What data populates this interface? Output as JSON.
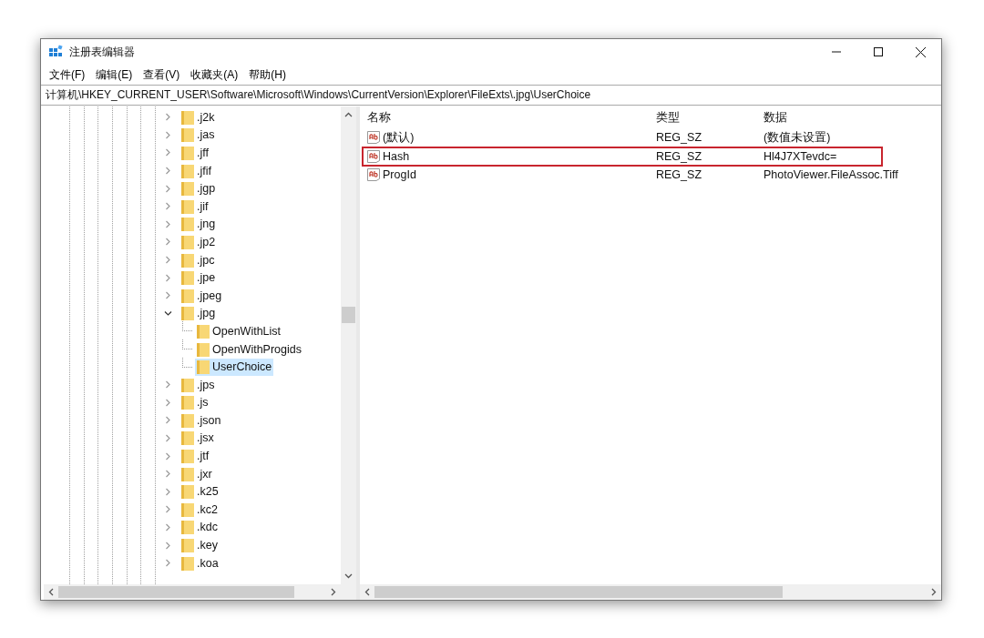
{
  "window": {
    "title": "注册表编辑器"
  },
  "menu": [
    "文件(F)",
    "编辑(E)",
    "查看(V)",
    "收藏夹(A)",
    "帮助(H)"
  ],
  "address": "计算机\\HKEY_CURRENT_USER\\Software\\Microsoft\\Windows\\CurrentVersion\\Explorer\\FileExts\\.jpg\\UserChoice",
  "tree": {
    "items": [
      {
        "label": ".j2k",
        "expanded": false,
        "selected": false
      },
      {
        "label": ".jas",
        "expanded": false,
        "selected": false
      },
      {
        "label": ".jff",
        "expanded": false,
        "selected": false
      },
      {
        "label": ".jfif",
        "expanded": false,
        "selected": false
      },
      {
        "label": ".jgp",
        "expanded": false,
        "selected": false
      },
      {
        "label": ".jif",
        "expanded": false,
        "selected": false
      },
      {
        "label": ".jng",
        "expanded": false,
        "selected": false
      },
      {
        "label": ".jp2",
        "expanded": false,
        "selected": false
      },
      {
        "label": ".jpc",
        "expanded": false,
        "selected": false
      },
      {
        "label": ".jpe",
        "expanded": false,
        "selected": false
      },
      {
        "label": ".jpeg",
        "expanded": false,
        "selected": false
      },
      {
        "label": ".jpg",
        "expanded": true,
        "selected": false,
        "children": [
          {
            "label": "OpenWithList",
            "selected": false
          },
          {
            "label": "OpenWithProgids",
            "selected": false
          },
          {
            "label": "UserChoice",
            "selected": true
          }
        ]
      },
      {
        "label": ".jps",
        "expanded": false,
        "selected": false
      },
      {
        "label": ".js",
        "expanded": false,
        "selected": false
      },
      {
        "label": ".json",
        "expanded": false,
        "selected": false
      },
      {
        "label": ".jsx",
        "expanded": false,
        "selected": false
      },
      {
        "label": ".jtf",
        "expanded": false,
        "selected": false
      },
      {
        "label": ".jxr",
        "expanded": false,
        "selected": false
      },
      {
        "label": ".k25",
        "expanded": false,
        "selected": false
      },
      {
        "label": ".kc2",
        "expanded": false,
        "selected": false
      },
      {
        "label": ".kdc",
        "expanded": false,
        "selected": false
      },
      {
        "label": ".key",
        "expanded": false,
        "selected": false
      },
      {
        "label": ".koa",
        "expanded": false,
        "selected": false
      }
    ]
  },
  "values": {
    "columns": [
      "名称",
      "类型",
      "数据"
    ],
    "rows": [
      {
        "name": "(默认)",
        "type": "REG_SZ",
        "data": "(数值未设置)",
        "highlighted": false
      },
      {
        "name": "Hash",
        "type": "REG_SZ",
        "data": "Hl4J7XTevdc=",
        "highlighted": true
      },
      {
        "name": "ProgId",
        "type": "REG_SZ",
        "data": "PhotoViewer.FileAssoc.Tiff",
        "highlighted": false
      }
    ]
  }
}
